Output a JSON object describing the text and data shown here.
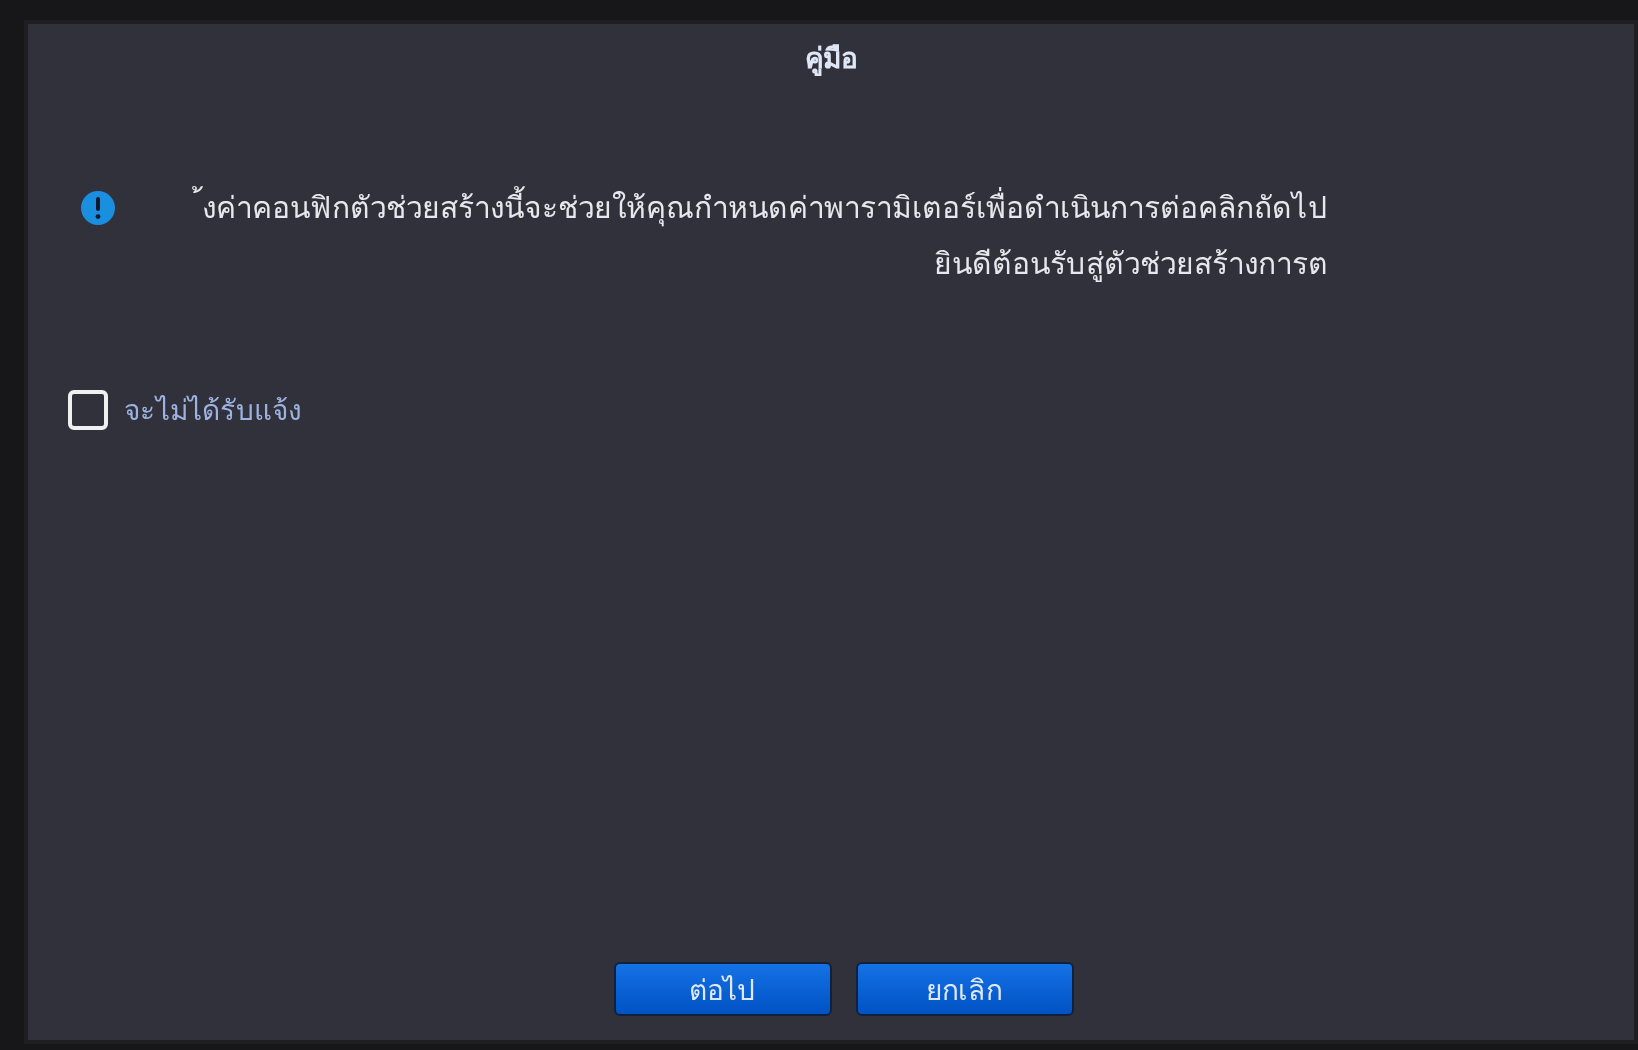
{
  "window": {
    "title": "คู่มือ"
  },
  "message": {
    "lines": [
      "้งค่าคอนฟิกตัวช่วยสร้างนี้จะช่วยให้คุณกำหนดค่าพารามิเตอร์เพื่อดำเนินการต่อคลิกถัดไป",
      "ยินดีต้อนรับสู่ตัวช่วยสร้างการต"
    ]
  },
  "checkbox": {
    "label": "จะไม่ได้รับแจ้ง",
    "checked": false
  },
  "buttons": [
    "ต่อไป",
    "ยกเลิก"
  ]
}
